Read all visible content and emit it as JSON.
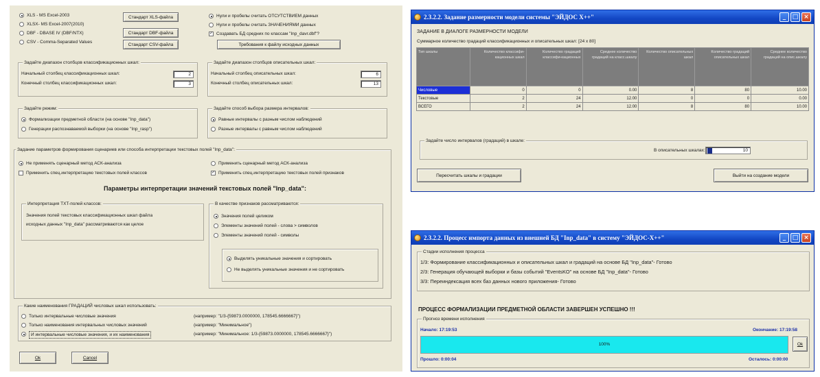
{
  "left": {
    "formats": [
      {
        "label": "XLS - MS Excel-2003",
        "selected": true
      },
      {
        "label": "XLSX- MS Excel-2007(2010)",
        "selected": false
      },
      {
        "label": "DBF - DBASE IV (DBF/NTX)",
        "selected": false
      },
      {
        "label": "CSV - Comma-Separated Values",
        "selected": false
      }
    ],
    "std_buttons": [
      "Стандарт XLS-файла",
      "Стандарт DBF-файла",
      "Стандарт CSV-файла"
    ],
    "null_options": [
      {
        "label": "Нули и пробелы считать ОТСУТСТВИЕМ данных",
        "selected": true
      },
      {
        "label": "Нули и пробелы считать ЗНАЧЕНИЯМИ данных",
        "selected": false
      }
    ],
    "create_db_checkbox": {
      "label": "Создавать БД средних по классам \"Inp_davr.dbf\"?",
      "checked": true
    },
    "requirements_button": "Требования к файлу исходных данных",
    "class_range": {
      "title": "Задайте диапазон столбцов классификационных шкал:",
      "start_label": "Начальный столбец классификационных шкал:",
      "start_value": "2",
      "end_label": "Конечный столбец классификационных шкал:",
      "end_value": "3"
    },
    "desc_range": {
      "title": "Задайте диапазон столбцов описательных шкал:",
      "start_label": "Начальный столбец описательных шкал:",
      "start_value": "6",
      "end_label": "Конечный столбец описательных шкал:",
      "end_value": "13"
    },
    "mode": {
      "title": "Задайте режим:",
      "options": [
        {
          "label": "Формализации предметной области (на основе \"Inp_data\")",
          "selected": true
        },
        {
          "label": "Генерации распознаваемой выборки (на основе \"Inp_rasp\")",
          "selected": false
        }
      ]
    },
    "interval": {
      "title": "Задайте способ выбора размера интервалов:",
      "options": [
        {
          "label": "Равные интервалы с разным числом наблюдений",
          "selected": true
        },
        {
          "label": "Разные интервалы с равным числом наблюдений",
          "selected": false
        }
      ]
    },
    "scenario": {
      "title": "Задание параметров формирования сценариев или способа интерпретации текстовых полей \"Inp_data\":",
      "left_options": [
        {
          "label": "Не применять сценарный метод АСК-анализа",
          "kind": "radio",
          "on": true
        },
        {
          "label": "Применить спец.интерпретацию текстовых полей классов",
          "kind": "check",
          "on": false
        }
      ],
      "right_options": [
        {
          "label": "Применить сценарный метод АСК-анализа",
          "kind": "radio",
          "on": false
        },
        {
          "label": "Применить спец.интерпретацию текстовых полей признаков",
          "kind": "check",
          "on": true
        }
      ],
      "heading": "Параметры интерпретации значений текстовых полей \"Inp_data\":",
      "txt_box_title": "Интерпретация TXT-полей классов:",
      "txt_box_text1": "Значения полей текстовых классификационных шкал файла",
      "txt_box_text2": "исходных данных \"Inp_data\" рассматриваются как целое",
      "attr_title": "В качестве признаков рассматриваются:",
      "attr_options": [
        {
          "label": "Значения полей целиком",
          "selected": true
        },
        {
          "label": "Элементы значений полей - слова > символов",
          "selected": false
        },
        {
          "label": "Элементы значений полей - символы",
          "selected": false
        }
      ],
      "uniq_options": [
        {
          "label": "Выделять уникальные значения и сортировать",
          "selected": true
        },
        {
          "label": "Не выделять уникальные значения и не сортировать",
          "selected": false
        }
      ]
    },
    "gradations": {
      "title": "Какие наименования ГРАДАЦИЙ числовых шкал использовать:",
      "options": [
        {
          "label": "Только интервальные числовые значения",
          "example": "(например: \"1/3-{59873.0000000, 178545.6666667}\")",
          "selected": false
        },
        {
          "label": "Только наименования интервальных числовых значений",
          "example": "(например: \"Минимальное\")",
          "selected": false
        },
        {
          "label": "И интервальные числовые значения, и их наименования",
          "example": "(например: \"Минимальное: 1/3-{59873.0000000, 178545.6666667}\")",
          "selected": true
        }
      ]
    },
    "ok": "Ok",
    "cancel": "Cancel"
  },
  "dim_window": {
    "title": "2.3.2.2. Задание размерности модели системы \"ЭЙДОС Х++\"",
    "heading": "ЗАДАНИЕ В ДИАЛОГЕ РАЗМЕРНОСТИ МОДЕЛИ",
    "subheading": "Суммарное количество градаций классификационных и описательных шкал: [24 x 80]",
    "columns": [
      "Тип шкалы",
      "Количество классифи-кационных шкал",
      "Количество градаций классифи-кационных",
      "Среднее количество градаций на класс.шкалу",
      "Количество описательных шкал",
      "Количество градаций описательных шкал",
      "Среднее количество градаций на опис.шкалу"
    ],
    "rows": [
      [
        "Числовые",
        "0",
        "0",
        "0.00",
        "8",
        "80",
        "10.00"
      ],
      [
        "Текстовые",
        "2",
        "24",
        "12.00",
        "0",
        "0",
        "0.00"
      ],
      [
        "ВСЕГО",
        "2",
        "24",
        "12.00",
        "8",
        "80",
        "10.00"
      ]
    ],
    "intervals_title": "Задайте число интервалов (градаций) в шкале:",
    "intervals_label": "В описательных шкалах:",
    "intervals_value": "10",
    "recalc_button": "Пересчитать шкалы и градации",
    "exit_button": "Выйти на создание модели"
  },
  "process_window": {
    "title": "2.3.2.2. Процесс импорта данных из внешней БД \"Inp_data\" в систему \"ЭЙДОС-Х++\"",
    "stages_title": "Стадии исполнения процесса",
    "stages": [
      "1/3: Формирование классификационных и описательных шкал и градаций на основе БД \"Inp_data\"- Готово",
      "2/3: Генерация обучающей выборки и базы событий \"EventsKO\" на основе БД \"Inp_data\"- Готово",
      "3/3: Переиндексация всех баз данных нового приложения- Готово"
    ],
    "done_text": "ПРОЦЕСС ФОРМАЛИЗАЦИИ ПРЕДМЕТНОЙ ОБЛАСТИ ЗАВЕРШЕН УСПЕШНО !!!",
    "forecast_title": "Прогноз времени исполнения",
    "start_label": "Начало: 17:19:53",
    "end_label": "Окончание: 17:19:58",
    "progress_text": "100%",
    "progress": 1.0,
    "elapsed_label": "Прошло: 0:00:04",
    "remaining_label": "Осталось: 0:00:00",
    "ok": "Ok",
    "colors": {
      "progress": "#19e8ee",
      "titlebar": "#1347c4"
    }
  }
}
